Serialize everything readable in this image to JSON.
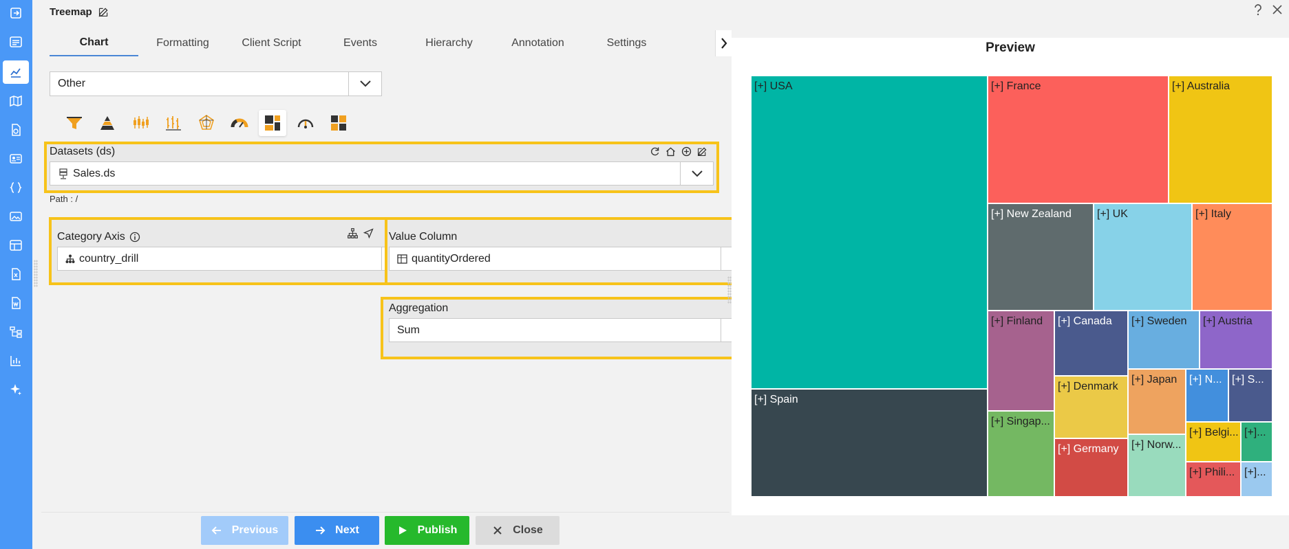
{
  "editor": {
    "title": "Treemap",
    "tabs": [
      "Chart",
      "Formatting",
      "Client Script",
      "Events",
      "Hierarchy",
      "Annotation",
      "Settings"
    ],
    "chart_category": "Other",
    "datasets": {
      "label": "Datasets (ds)",
      "value": "Sales.ds",
      "path": "Path : /"
    },
    "category_axis": {
      "label": "Category Axis",
      "value": "country_drill"
    },
    "value_column": {
      "label": "Value Column",
      "value": "quantityOrdered"
    },
    "aggregation": {
      "label": "Aggregation",
      "value": "Sum"
    }
  },
  "footer": {
    "previous": "Previous",
    "next": "Next",
    "publish": "Publish",
    "close": "Close"
  },
  "preview": {
    "title": "Preview",
    "cells": [
      {
        "label": "[+] USA",
        "color": "#00b5a5"
      },
      {
        "label": "[+] Spain",
        "color": "#37474f"
      },
      {
        "label": "[+] France",
        "color": "#fc605b"
      },
      {
        "label": "[+] Australia",
        "color": "#f0c514"
      },
      {
        "label": "[+] New Zealand",
        "color": "#5f6b6d"
      },
      {
        "label": "[+] UK",
        "color": "#87d2e8"
      },
      {
        "label": "[+] Italy",
        "color": "#ff8c5a"
      },
      {
        "label": "[+] Finland",
        "color": "#a6628e"
      },
      {
        "label": "[+] Canada",
        "color": "#4a5a8d"
      },
      {
        "label": "[+] Sweden",
        "color": "#68aee0"
      },
      {
        "label": "[+] Austria",
        "color": "#8e66c9"
      },
      {
        "label": "[+] Singap...",
        "color": "#74b862"
      },
      {
        "label": "[+] Denmark",
        "color": "#ebc947"
      },
      {
        "label": "[+] Japan",
        "color": "#eea35f"
      },
      {
        "label": "[+] N...",
        "color": "#428fdd"
      },
      {
        "label": "[+] S...",
        "color": "#4a5a8d"
      },
      {
        "label": "[+] Germany",
        "color": "#d24b45"
      },
      {
        "label": "[+] Norw...",
        "color": "#99dbbd"
      },
      {
        "label": "[+] Belgi...",
        "color": "#f0c514"
      },
      {
        "label": "[+]...",
        "color": "#2fb07d"
      },
      {
        "label": "[+] Phili...",
        "color": "#e4585a"
      },
      {
        "label": "[+]...",
        "color": "#9bc9ef"
      }
    ]
  },
  "colors": {
    "rail": "#4a98f7",
    "highlight": "#f7c31a",
    "next": "#3b8ef0",
    "publish": "#26b92c",
    "previous": "#a2cbfa",
    "close": "#dcdcdc"
  }
}
